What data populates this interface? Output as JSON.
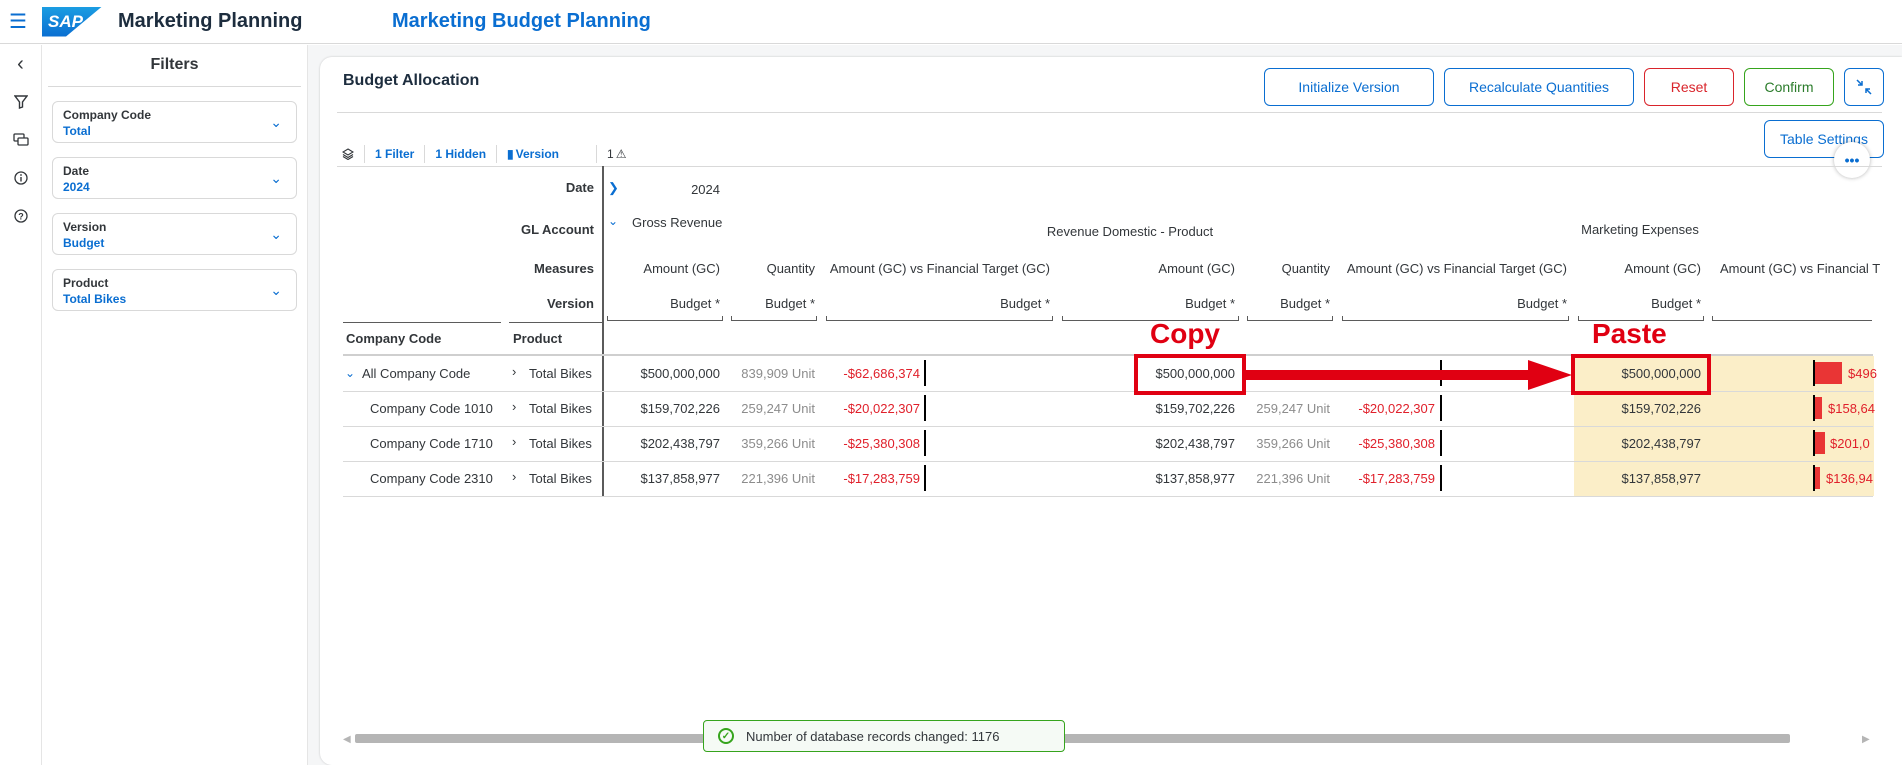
{
  "shell": {
    "logo_text": "SAP",
    "app_title": "Marketing Planning",
    "page_title": "Marketing Budget Planning"
  },
  "filters": {
    "title": "Filters",
    "items": [
      {
        "label": "Company Code",
        "value": "Total"
      },
      {
        "label": "Date",
        "value": "2024"
      },
      {
        "label": "Version",
        "value": "Budget"
      },
      {
        "label": "Product",
        "value": "Total Bikes"
      }
    ]
  },
  "card": {
    "title": "Budget Allocation",
    "buttons": {
      "initialize": "Initialize Version",
      "recalculate": "Recalculate Quantities",
      "reset": "Reset",
      "confirm": "Confirm",
      "table_settings": "Table Settings"
    }
  },
  "toolbar": {
    "filter": "1 Filter",
    "hidden": "1 Hidden",
    "version": "Version",
    "warning_count": "1"
  },
  "table": {
    "dim_labels": {
      "date": "Date",
      "gl_account": "GL Account",
      "measures": "Measures",
      "version": "Version",
      "company_code": "Company Code",
      "product": "Product"
    },
    "date_value": "2024",
    "gl_root": "Gross Revenue",
    "group_headers": [
      "Revenue Domestic - Product",
      "Marketing Expenses"
    ],
    "measures": [
      "Amount (GC)",
      "Quantity",
      "Amount (GC) vs Financial Target (GC)",
      "Amount (GC)",
      "Quantity",
      "Amount (GC) vs Financial Target (GC)",
      "Amount (GC)",
      "Amount (GC) vs Financial T"
    ],
    "version_label": "Budget *",
    "rows": [
      {
        "company": "All Company Code",
        "product": "Total Bikes",
        "amt1": "$500,000,000",
        "qty1": "839,909 Unit",
        "var1": "-$62,686,374",
        "amt2": "$500,000,000",
        "qty2": "",
        "var2": "",
        "amt3": "$500,000,000",
        "var3": "$496"
      },
      {
        "company": "Company Code 1010",
        "product": "Total Bikes",
        "amt1": "$159,702,226",
        "qty1": "259,247 Unit",
        "var1": "-$20,022,307",
        "amt2": "$159,702,226",
        "qty2": "259,247 Unit",
        "var2": "-$20,022,307",
        "amt3": "$159,702,226",
        "var3": "$158,64"
      },
      {
        "company": "Company Code 1710",
        "product": "Total Bikes",
        "amt1": "$202,438,797",
        "qty1": "359,266 Unit",
        "var1": "-$25,380,308",
        "amt2": "$202,438,797",
        "qty2": "359,266 Unit",
        "var2": "-$25,380,308",
        "amt3": "$202,438,797",
        "var3": "$201,0"
      },
      {
        "company": "Company Code 2310",
        "product": "Total Bikes",
        "amt1": "$137,858,977",
        "qty1": "221,396 Unit",
        "var1": "-$17,283,759",
        "amt2": "$137,858,977",
        "qty2": "221,396 Unit",
        "var2": "-$17,283,759",
        "amt3": "$137,858,977",
        "var3": "$136,94"
      }
    ]
  },
  "annotations": {
    "copy": "Copy",
    "paste": "Paste"
  },
  "toast": {
    "message": "Number of database records changed: 1176"
  },
  "colors": {
    "accent": "#0a6ed1",
    "negative": "#e0202b",
    "paste_highlight": "#fbeec8",
    "annotation": "#e00012",
    "success": "#36a41d"
  }
}
